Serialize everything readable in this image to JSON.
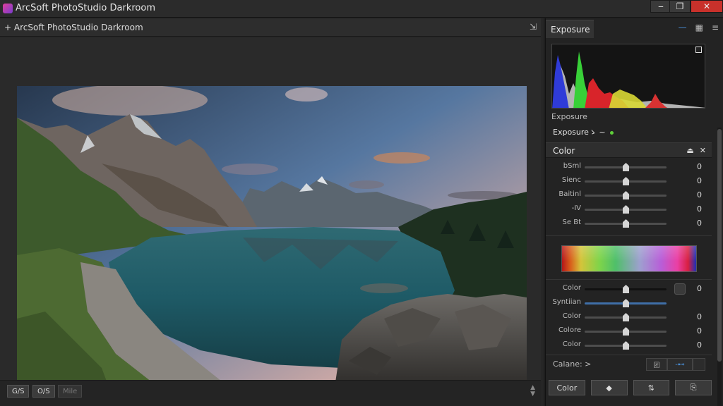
{
  "window": {
    "title": "ArcSoft PhotoStudio Darkroom",
    "minimize": "‒",
    "maximize": "❐",
    "close": "✕"
  },
  "document": {
    "title": "ArcSoft PhotoStudio Darkroom",
    "add_icon": "+",
    "pin_icon": "⇲"
  },
  "status_bar": {
    "buttons": [
      "G/S",
      "O/S",
      "Mile"
    ]
  },
  "panel": {
    "tab_label": "Exposure",
    "icons": [
      "—",
      "▦",
      "≡"
    ],
    "exposure_label": "Exposure",
    "exposure_sub": "Exposureゝ ~",
    "color_section": {
      "title": "Color",
      "icons": [
        "⏏",
        "✕"
      ],
      "sliders": [
        {
          "label": "bSml",
          "value": "0",
          "pos": 0.5
        },
        {
          "label": "Sienc",
          "value": "0",
          "pos": 0.5
        },
        {
          "label": "Baitinl",
          "value": "0",
          "pos": 0.5
        },
        {
          "label": "-IV",
          "value": "0",
          "pos": 0.5
        },
        {
          "label": "Se Bt",
          "value": "0",
          "pos": 0.5
        }
      ],
      "color_sliders": [
        {
          "label": "Color",
          "value": "0",
          "pos": 0.5
        },
        {
          "label": "Syntiian",
          "value": "",
          "pos": 0.5
        },
        {
          "label": "Color",
          "value": "0",
          "pos": 0.5
        },
        {
          "label": "Colore",
          "value": "0",
          "pos": 0.5
        },
        {
          "label": "Color",
          "value": "0",
          "pos": 0.5
        }
      ]
    },
    "balance": {
      "label": "Calane:",
      "arrow": ">",
      "box1": "团",
      "box2": "-⊷"
    },
    "bottom_buttons": [
      "Color",
      "◆",
      "⇅",
      "⎘"
    ]
  },
  "colors": {
    "accent_blue": "#4a8fd8",
    "close_red": "#c8312b"
  }
}
